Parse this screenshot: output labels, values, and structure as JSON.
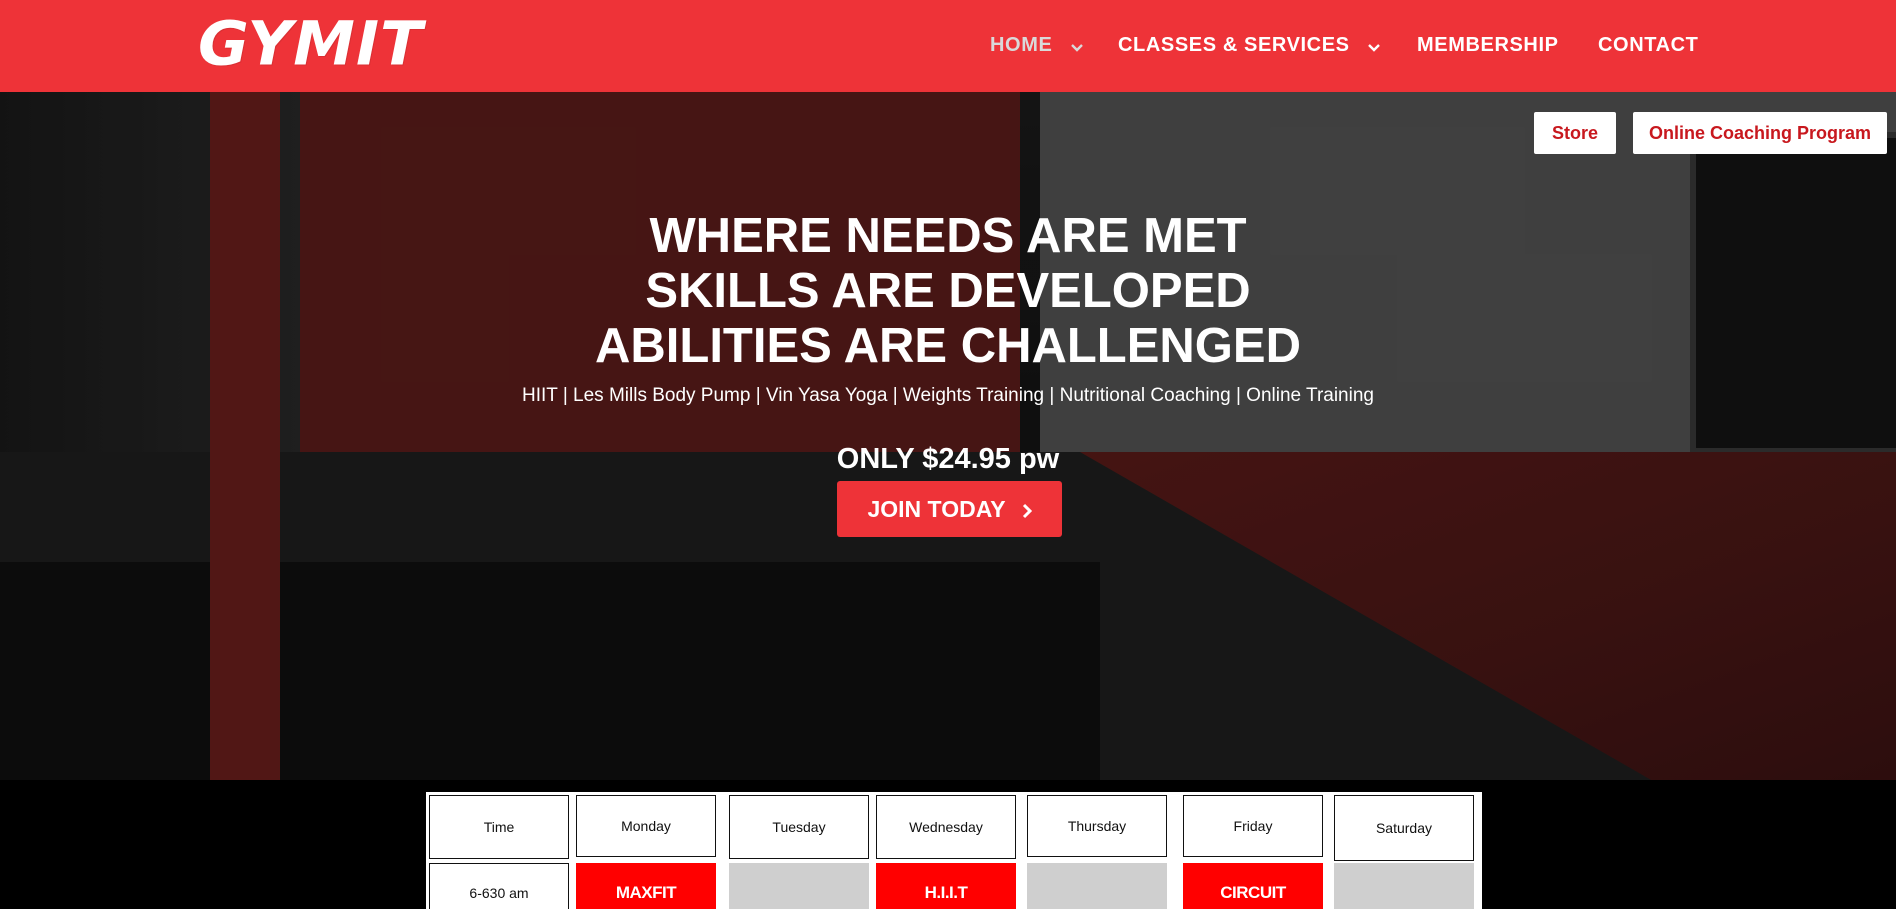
{
  "header": {
    "logo": "GYMIT",
    "nav": [
      {
        "label": "HOME",
        "has_dropdown": true,
        "active": true
      },
      {
        "label": "CLASSES & SERVICES",
        "has_dropdown": true,
        "active": false
      },
      {
        "label": "MEMBERSHIP",
        "has_dropdown": false,
        "active": false
      },
      {
        "label": "CONTACT",
        "has_dropdown": false,
        "active": false
      }
    ]
  },
  "hero": {
    "buttons": {
      "store": "Store",
      "online_coaching": "Online Coaching Program"
    },
    "headline": [
      "WHERE NEEDS ARE MET",
      "SKILLS ARE DEVELOPED",
      "ABILITIES ARE CHALLENGED"
    ],
    "subline": "HIIT | Les Mills Body Pump | Vin Yasa Yoga | Weights Training | Nutritional Coaching | Online Training",
    "price": "ONLY $24.95 pw",
    "cta": "JOIN TODAY"
  },
  "timetable": {
    "headers": [
      "Time",
      "Monday",
      "Tuesday",
      "Wednesday",
      "Thursday",
      "Friday",
      "Saturday"
    ],
    "rows": [
      {
        "time": "6-630 am",
        "cells": [
          {
            "label": "MAXFIT",
            "style": "red"
          },
          {
            "label": "",
            "style": "grey"
          },
          {
            "label": "H.I.I.T",
            "style": "red"
          },
          {
            "label": "",
            "style": "grey"
          },
          {
            "label": "CIRCUIT",
            "style": "red"
          },
          {
            "label": "",
            "style": "grey"
          }
        ]
      }
    ]
  },
  "colors": {
    "brand_red": "#ee3338",
    "white": "#ffffff",
    "cell_grey": "#cfcfcf",
    "cell_red": "#ff0000"
  }
}
